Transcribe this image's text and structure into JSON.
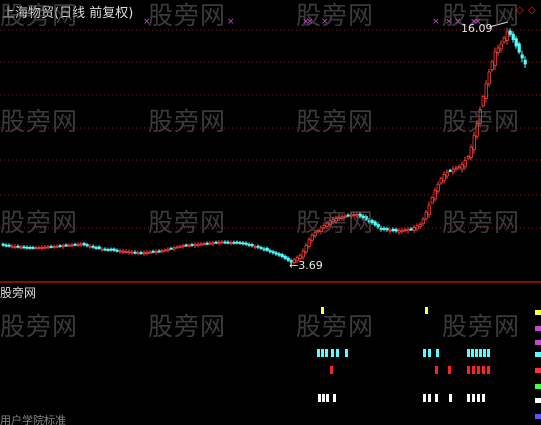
{
  "window": {
    "title": "上海物贸(日线 前复权)"
  },
  "watermark": {
    "text": "股旁网"
  },
  "price_chart": {
    "high_label": "16.09",
    "low_label": "3.69",
    "colors": {
      "up": "#ff3b3b",
      "down": "#54ffff",
      "marker": "#cc44cc",
      "separator": "#b01010",
      "grid": "#8b1c1c"
    }
  },
  "indicator_panel": {
    "label": "股旁网",
    "bottom_label": "用户学院标准",
    "colors": {
      "yellow": "#ffff44",
      "cyan": "#54ffff",
      "red": "#ff2222",
      "white": "#ffffff"
    }
  }
}
